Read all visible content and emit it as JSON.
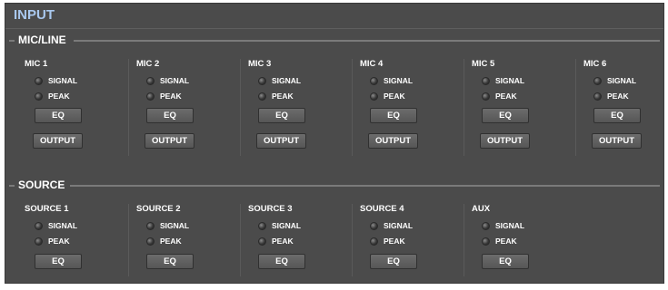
{
  "panel": {
    "title": "INPUT"
  },
  "sections": {
    "micline": {
      "label": "MIC/LINE",
      "channels": [
        {
          "name": "MIC 1",
          "signal": "SIGNAL",
          "peak": "PEAK",
          "eq": "EQ",
          "output": "OUTPUT"
        },
        {
          "name": "MIC 2",
          "signal": "SIGNAL",
          "peak": "PEAK",
          "eq": "EQ",
          "output": "OUTPUT"
        },
        {
          "name": "MIC 3",
          "signal": "SIGNAL",
          "peak": "PEAK",
          "eq": "EQ",
          "output": "OUTPUT"
        },
        {
          "name": "MIC 4",
          "signal": "SIGNAL",
          "peak": "PEAK",
          "eq": "EQ",
          "output": "OUTPUT"
        },
        {
          "name": "MIC 5",
          "signal": "SIGNAL",
          "peak": "PEAK",
          "eq": "EQ",
          "output": "OUTPUT"
        },
        {
          "name": "MIC 6",
          "signal": "SIGNAL",
          "peak": "PEAK",
          "eq": "EQ",
          "output": "OUTPUT"
        }
      ]
    },
    "source": {
      "label": "SOURCE",
      "channels": [
        {
          "name": "SOURCE 1",
          "signal": "SIGNAL",
          "peak": "PEAK",
          "eq": "EQ"
        },
        {
          "name": "SOURCE 2",
          "signal": "SIGNAL",
          "peak": "PEAK",
          "eq": "EQ"
        },
        {
          "name": "SOURCE 3",
          "signal": "SIGNAL",
          "peak": "PEAK",
          "eq": "EQ"
        },
        {
          "name": "SOURCE 4",
          "signal": "SIGNAL",
          "peak": "PEAK",
          "eq": "EQ"
        },
        {
          "name": "AUX",
          "signal": "SIGNAL",
          "peak": "PEAK",
          "eq": "EQ"
        }
      ]
    }
  },
  "colors": {
    "panel_bg": "#4b4b4b",
    "title": "#a9c8ee",
    "led_off": "#2b2b2b"
  },
  "icons": {
    "indicator": "led-indicator-icon"
  }
}
